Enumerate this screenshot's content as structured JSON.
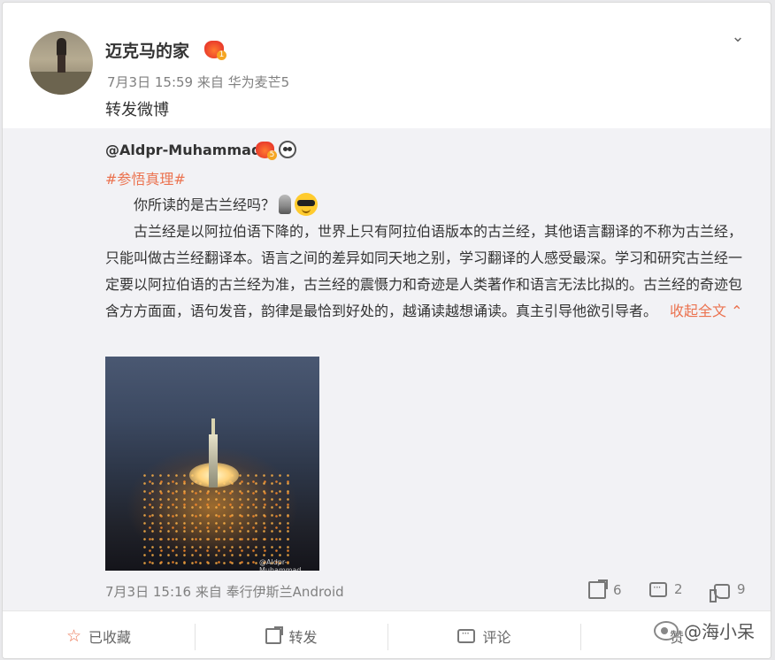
{
  "post": {
    "author": "迈克马的家",
    "time": "7月3日 15:59",
    "source_prefix": "来自",
    "device": "华为麦芒5",
    "repost_text": "转发微博"
  },
  "quoted": {
    "author": "@Aldpr-Muhammad",
    "hashtag": "#参悟真理#",
    "paragraph1": "你所读的是古兰经吗？",
    "paragraph2": "古兰经是以阿拉伯语下降的，世界上只有阿拉伯语版本的古兰经，其他语言翻译的不称为古兰经，只能叫做古兰经翻译本。语言之间的差异如同天地之别，学习翻译的人感受最深。学习和研究古兰经一定要以阿拉伯语的古兰经为准，古兰经的震慑力和奇迹是人类著作和语言无法比拟的。古兰经的奇迹包含方方面面，语句发音，韵律是最恰到好处的，越诵读越想诵读。真主引导他欲引导者。",
    "collapse_label": "收起全文",
    "photo_watermark": "@Aldpr-Muhammad",
    "time": "7月3日 15:16",
    "source_prefix": "来自",
    "device": "奉行伊斯兰Android",
    "forward_count": "6",
    "comment_count": "2",
    "like_count": "9"
  },
  "actions": {
    "favorite_label": "已收藏",
    "forward_label": "转发",
    "comment_label": "评论",
    "like_label": "赞"
  },
  "overlay": {
    "watermark_text": "@海小呆"
  },
  "icons": {
    "more": "chevron-down-icon",
    "forward": "share-icon",
    "comment": "comment-icon",
    "like": "thumbs-up-icon",
    "favorite": "star-icon"
  },
  "colors": {
    "accent": "#eb7350",
    "meta": "#808080",
    "quoted_bg": "#f2f2f5"
  }
}
